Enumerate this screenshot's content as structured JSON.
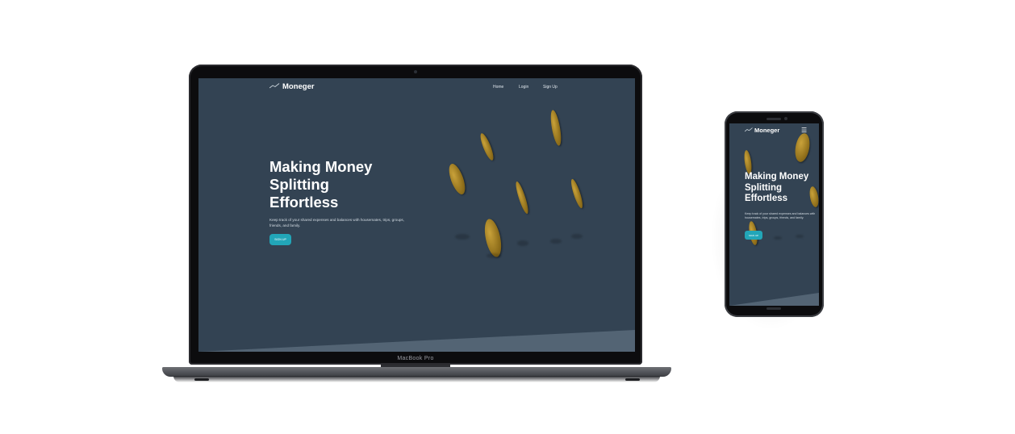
{
  "brand": {
    "name": "Moneger"
  },
  "nav": {
    "items": [
      "Home",
      "Login",
      "Sign Up"
    ]
  },
  "hero": {
    "title_lines": [
      "Making Money",
      "Splitting",
      "Effortless"
    ],
    "subtitle": "Keep track of your shared expenses and balances with housemates, trips, groups, friends, and family.",
    "cta": "SIGN UP"
  },
  "device": {
    "laptop_label": "MacBook Pro"
  },
  "colors": {
    "screen_bg": "#334353",
    "accent": "#22a6b8",
    "coin": "#b08a2a"
  },
  "icons": {
    "menu": "hamburger-menu-icon",
    "logo": "chart-line-logo-icon"
  }
}
